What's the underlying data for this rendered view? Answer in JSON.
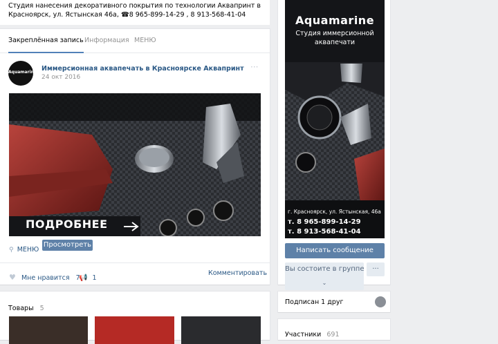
{
  "header": {
    "description_line1": "Студия нанесения декоративного покрытия по технологии Аквапринт в",
    "description_line2": "Красноярск, ул. Ястынская 46а, ☎8 965-899-14-29 , 8 913-568-41-04"
  },
  "tabs": [
    {
      "label": "Закреплённая запись",
      "active": true
    },
    {
      "label": "Информация",
      "active": false
    },
    {
      "label": "МЕНЮ",
      "active": false
    }
  ],
  "post": {
    "avatar_brand": "Aquamarine",
    "author": "Иммерсионная аквапечать в Красноярске Аквапринт",
    "date": "24 окт 2016",
    "more": "···",
    "image_overlay": "ПОДРОБНЕЕ",
    "menu_link": "МЕНЮ",
    "view_button": "Просмотреть",
    "likes_label": "Мне нравится",
    "likes_count": "7",
    "shares_count": "1",
    "comment_label": "Комментировать"
  },
  "goods": {
    "title": "Товары",
    "count": "5"
  },
  "cover": {
    "brand": "Aquamarine",
    "line1": "Студия иммерсионной",
    "line2": "аквапечати",
    "address": "г. Красноярск, ул. Ястынская, 46а",
    "phone1": "т. 8 965-899-14-29",
    "phone2": "т. 8 913-568-41-04"
  },
  "sidebar": {
    "message_button": "Написать сообщение",
    "member_button": "Вы состоите в группе",
    "more_button": "···",
    "friends_label": "Подписан 1 друг",
    "members_label": "Участники",
    "members_count": "691"
  },
  "colors": {
    "background": "#edeef0",
    "link": "#2a5885",
    "button": "#5e81a8",
    "accent_red": "#8b1c1c"
  }
}
